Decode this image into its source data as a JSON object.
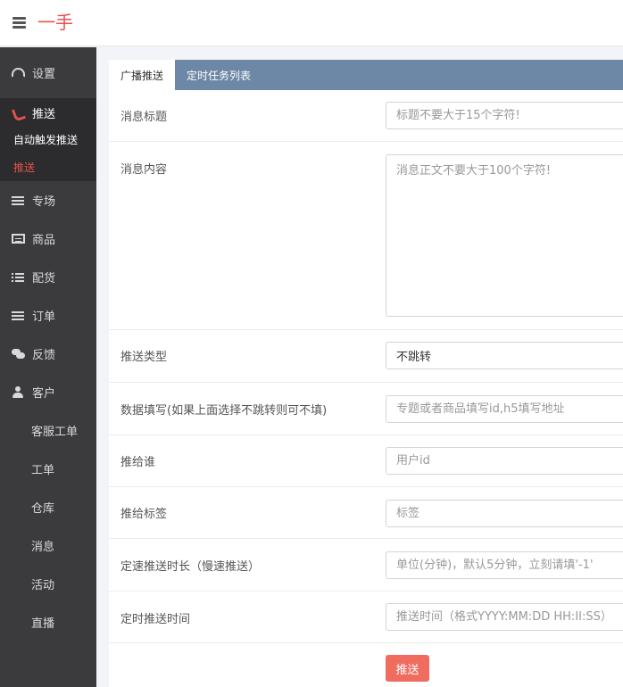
{
  "header": {
    "brand": "一手",
    "menu_icon": "hamburger-icon"
  },
  "sidebar": {
    "settings": {
      "label": "设置",
      "icon": "dashboard-icon"
    },
    "push": {
      "label": "推送",
      "icon": "phone-icon",
      "children": [
        {
          "label": "自动触发推送"
        },
        {
          "label": "推送"
        }
      ]
    },
    "items": [
      {
        "label": "专场",
        "icon": "list-icon"
      },
      {
        "label": "商品",
        "icon": "card-icon"
      },
      {
        "label": "配货",
        "icon": "ordered-list-icon"
      },
      {
        "label": "订单",
        "icon": "list-icon"
      },
      {
        "label": "反馈",
        "icon": "comments-icon"
      },
      {
        "label": "客户",
        "icon": "user-icon"
      }
    ],
    "plain_items": [
      "客服工单",
      "工单",
      "仓库",
      "消息",
      "活动",
      "直播"
    ]
  },
  "tabs": [
    {
      "label": "广播推送"
    },
    {
      "label": "定时任务列表"
    }
  ],
  "form": {
    "title": {
      "label": "消息标题",
      "placeholder": "标题不要大于15个字符!"
    },
    "content": {
      "label": "消息内容",
      "placeholder": "消息正文不要大于100个字符!"
    },
    "type": {
      "label": "推送类型",
      "value": "不跳转"
    },
    "data": {
      "label": "数据填写(如果上面选择不跳转则可不填)",
      "placeholder": "专题或者商品填写id,h5填写地址"
    },
    "target": {
      "label": "推给谁",
      "placeholder": "用户id"
    },
    "tag": {
      "label": "推给标签",
      "placeholder": "标签"
    },
    "duration": {
      "label": "定速推送时长（慢速推送）",
      "placeholder": "单位(分钟)，默认5分钟，立刻请填'-1'"
    },
    "schedule": {
      "label": "定时推送时间",
      "placeholder": "推送时间（格式YYYY:MM:DD HH:II:SS）"
    },
    "submit_label": "推送"
  },
  "colors": {
    "accent": "#e8514b",
    "sidebar_bg": "#3b3b3d",
    "tab_bar": "#6d87a6",
    "button": "#f06c5f"
  }
}
